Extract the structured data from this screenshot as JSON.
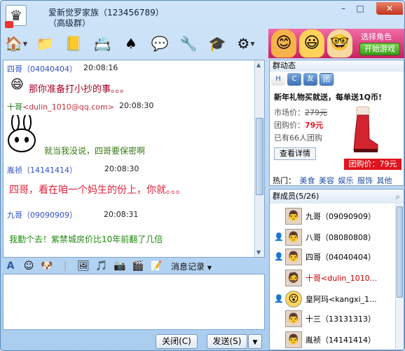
{
  "titlebar": {
    "group_name": "爱新觉罗家族（123456789）",
    "group_type": "（高级群）",
    "min_label": "–",
    "max_label": "□",
    "close_label": "✕"
  },
  "toolbar": {
    "tools": [
      {
        "name": "home-icon",
        "glyph": "🏠"
      },
      {
        "name": "folder-icon",
        "glyph": "📁"
      },
      {
        "name": "album-icon",
        "glyph": "📒"
      },
      {
        "name": "card-icon",
        "glyph": "📇"
      },
      {
        "name": "poker-icon",
        "glyph": "♠"
      },
      {
        "name": "chat-icon",
        "glyph": "💬"
      },
      {
        "name": "tools-icon",
        "glyph": "🔧"
      },
      {
        "name": "hat-icon",
        "glyph": "🎓"
      },
      {
        "name": "settings-icon",
        "glyph": "⚙"
      }
    ]
  },
  "banner": {
    "text": "选择角色",
    "button": "开始游戏"
  },
  "chat": {
    "messages": [
      {
        "sender": "四哥",
        "id": "（04040404）",
        "time": "20:08:16",
        "text": "那你准备打小抄的事。。。"
      },
      {
        "sender": "十哥",
        "id": "<dulin_1010@qq.com>",
        "time": "20:08:30",
        "text": "就当我没说，四哥要保密啊"
      },
      {
        "sender": "胤祯",
        "id": "（14141414）",
        "time": "20:08:30",
        "text": "四哥，看在咱一个妈生的份上，你就。。。"
      },
      {
        "sender": "九哥",
        "id": "（09090909）",
        "time": "20:08:31",
        "text": "我勤个去！紫禁城房价比10年前翻了几倍"
      }
    ]
  },
  "input_toolbar": {
    "history_label": "消息记录"
  },
  "buttons": {
    "close": "关闭(C)",
    "send": "发送(S)"
  },
  "notice": {
    "title": "群动态",
    "tabs": [
      "H",
      "C",
      "友",
      "团"
    ],
    "ad_title": "新年礼物买就送，每单送1Q币!",
    "market_label": "市场价：",
    "market_price": "279元",
    "group_label": "团购价：",
    "group_price": "79元",
    "bought": "已有66人团购",
    "detail_button": "查看详情",
    "price_tag": "团购价：79元",
    "hot_label": "热门：",
    "hot_links": [
      "美食",
      "美容",
      "娱乐",
      "服饰",
      "其他"
    ]
  },
  "members": {
    "title": "群成员(5/26)",
    "list": [
      {
        "name": "九哥（09090909）",
        "role": false,
        "avatar": "👨"
      },
      {
        "name": "八哥（08080808）",
        "role": true,
        "avatar": "👨"
      },
      {
        "name": "四哥（04040404）",
        "role": true,
        "avatar": "👨"
      },
      {
        "name": "十哥<dulin_1010...",
        "role": false,
        "avatar": "🧔",
        "highlight": true
      },
      {
        "name": "皇阿玛<kangxi_1...",
        "role": true,
        "avatar": "😮"
      },
      {
        "name": "十三（13131313）",
        "role": false,
        "avatar": "👨"
      },
      {
        "name": "胤祯（14141414）",
        "role": false,
        "avatar": "👨"
      }
    ]
  }
}
